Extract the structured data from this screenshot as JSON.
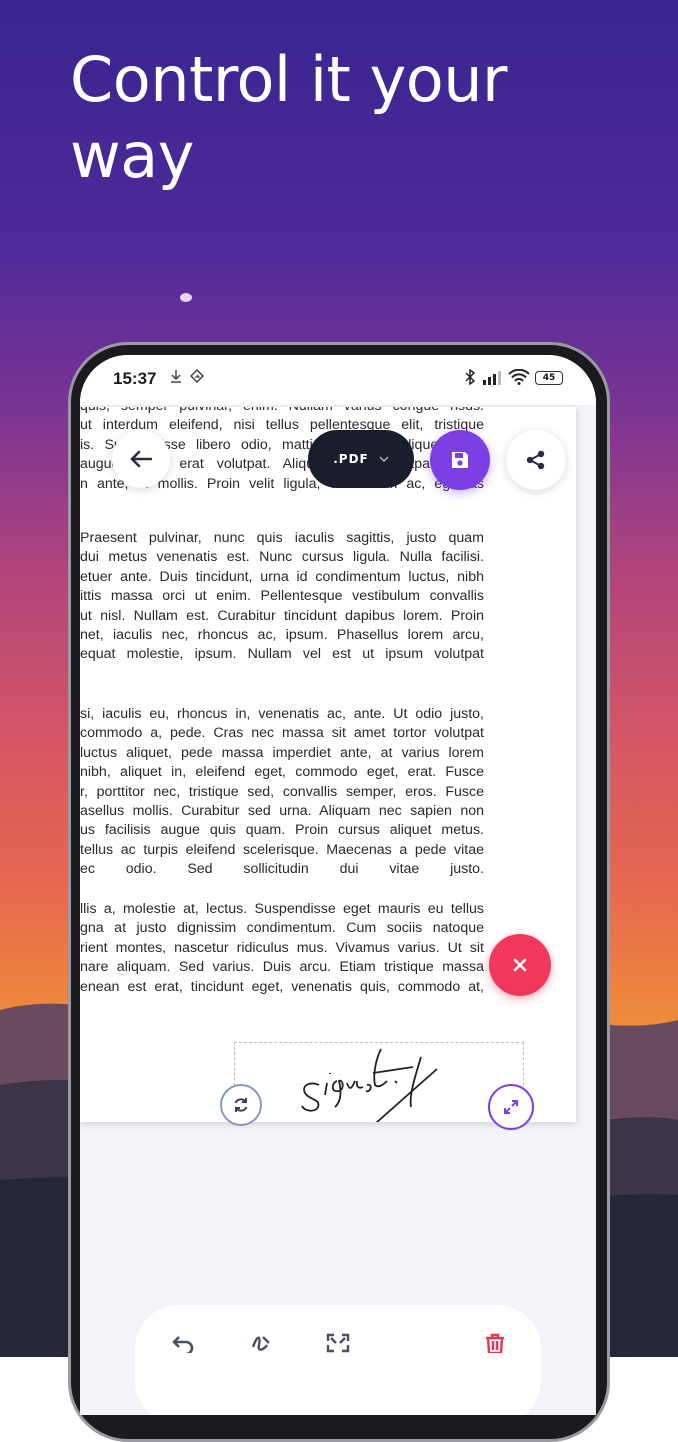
{
  "headline": "Control it your way",
  "status_bar": {
    "time": "15:37",
    "battery": "45"
  },
  "toolbar": {
    "format_label": ".PDF"
  },
  "document": {
    "paragraphs": [
      {
        "lines": [
          "quis, semper pulvinar, enim. Nullam varius congue risus.",
          "ut interdum eleifend, nisi tellus pellentesque elit, tristique",
          "is. Suspendisse libero odio, mattis sit amet, aliquet eget,",
          "augue. Nam erat volutpat. Aliquam erat volutpat. Proin",
          "n ante, in mollis. Proin velit ligula, vestibulum ac, egestas"
        ]
      },
      {
        "lines": [
          "Praesent pulvinar, nunc quis iaculis sagittis, justo quam",
          "dui metus venenatis est. Nunc cursus ligula. Nulla facilisi.",
          "etuer ante. Duis tincidunt, urna id condimentum luctus, nibh",
          "ittis massa orci ut enim. Pellentesque vestibulum convallis",
          "ut nisl. Nullam est. Curabitur tincidunt dapibus lorem. Proin",
          "net, iaculis nec, rhoncus ac, ipsum. Phasellus lorem arcu,",
          "equat molestie, ipsum. Nullam vel est ut ipsum volutpat"
        ]
      },
      {
        "lines": [
          "si, iaculis eu, rhoncus in, venenatis ac, ante. Ut odio justo,",
          "commodo a, pede. Cras nec massa sit amet tortor volutpat",
          "luctus aliquet, pede massa imperdiet ante, at varius lorem",
          "nibh, aliquet in, eleifend eget, commodo eget, erat. Fusce",
          "r, porttitor nec, tristique sed, convallis semper, eros. Fusce",
          "asellus mollis. Curabitur sed urna. Aliquam nec sapien non",
          "us facilisis augue quis quam. Proin cursus aliquet metus.",
          "tellus ac turpis eleifend scelerisque. Maecenas a pede vitae",
          "ec odio. Sed sollicitudin dui vitae justo."
        ]
      },
      {
        "lines": [
          "llis a, molestie at, lectus. Suspendisse eget mauris eu tellus",
          "gna at justo dignissim condimentum. Cum sociis natoque",
          "rient montes, nascetur ridiculus mus. Vivamus varius. Ut sit",
          "nare aliquam. Sed varius. Duis arcu. Etiam tristique massa",
          "enean est erat, tincidunt eget, venenatis quis, commodo at,"
        ]
      }
    ]
  },
  "icons": {
    "back": "arrow-left-icon",
    "save": "save-icon",
    "share": "share-icon",
    "close": "close-icon",
    "rotate": "rotate-icon",
    "resize": "expand-icon",
    "undo": "undo-icon",
    "signature": "signature-icon",
    "fit": "fit-screen-icon",
    "delete": "trash-icon"
  },
  "colors": {
    "accent": "#7b3fe4",
    "danger": "#f2385a",
    "dark": "#1a1d2c"
  }
}
